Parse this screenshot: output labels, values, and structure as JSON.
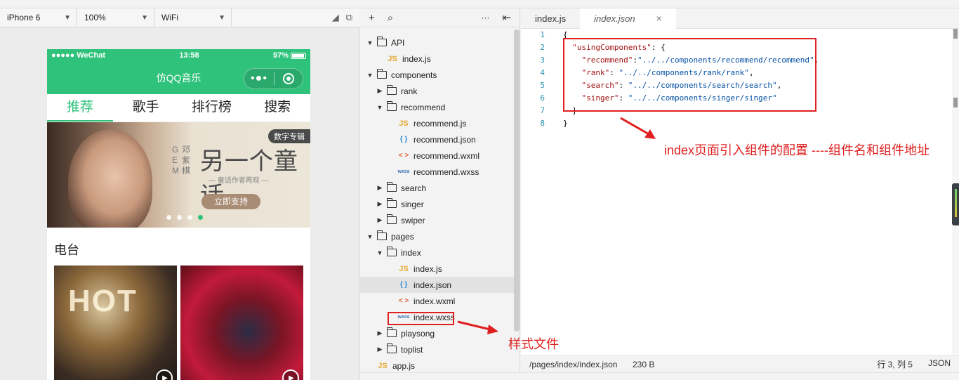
{
  "simulator": {
    "device": "iPhone 6",
    "zoom": "100%",
    "network": "WiFi",
    "status": {
      "carrier": "●●●●● WeChat",
      "time": "13:58",
      "battery": "97%"
    },
    "nav_title": "仿QQ音乐",
    "capsule_dots": "•●•",
    "tabs": [
      "推荐",
      "歌手",
      "排行榜",
      "搜索"
    ],
    "banner": {
      "album_tag": "数字专辑",
      "artist_col1": [
        "G",
        "E",
        "M"
      ],
      "artist_col2": [
        "邓",
        "紫",
        "棋"
      ],
      "title": "另一个童话",
      "subtitle": "— 童话作者再现 —",
      "support": "立即支持"
    },
    "radio_title": "电台",
    "radio_hot": "HOT"
  },
  "tree_toolbar": {
    "add": "+",
    "search": "⌕",
    "more": "···",
    "collapse": "⇤"
  },
  "file_tree": [
    {
      "label": "API",
      "type": "folder",
      "open": true,
      "level": 0
    },
    {
      "label": "index.js",
      "type": "js",
      "level": 1
    },
    {
      "label": "components",
      "type": "folder",
      "open": true,
      "level": 0
    },
    {
      "label": "rank",
      "type": "folder",
      "open": false,
      "level": 1
    },
    {
      "label": "recommend",
      "type": "folder",
      "open": true,
      "level": 1
    },
    {
      "label": "recommend.js",
      "type": "js",
      "level": 2
    },
    {
      "label": "recommend.json",
      "type": "json",
      "level": 2
    },
    {
      "label": "recommend.wxml",
      "type": "wxml",
      "level": 2
    },
    {
      "label": "recommend.wxss",
      "type": "wxss",
      "level": 2
    },
    {
      "label": "search",
      "type": "folder",
      "open": false,
      "level": 1
    },
    {
      "label": "singer",
      "type": "folder",
      "open": false,
      "level": 1
    },
    {
      "label": "swiper",
      "type": "folder",
      "open": false,
      "level": 1
    },
    {
      "label": "pages",
      "type": "folder",
      "open": true,
      "level": 0
    },
    {
      "label": "index",
      "type": "folder",
      "open": true,
      "level": 1
    },
    {
      "label": "index.js",
      "type": "js",
      "level": 2
    },
    {
      "label": "index.json",
      "type": "json",
      "level": 2,
      "selected": true
    },
    {
      "label": "index.wxml",
      "type": "wxml",
      "level": 2
    },
    {
      "label": "index.wxss",
      "type": "wxss",
      "level": 2
    },
    {
      "label": "playsong",
      "type": "folder",
      "open": false,
      "level": 1
    },
    {
      "label": "toplist",
      "type": "folder",
      "open": false,
      "level": 1
    },
    {
      "label": "app.js",
      "type": "js",
      "level": 0
    }
  ],
  "file_icons": {
    "js": "JS",
    "json": "{ }",
    "wxml": "< >",
    "wxss": "wxss"
  },
  "editor": {
    "tabs": [
      {
        "label": "index.js",
        "active": false
      },
      {
        "label": "index.json",
        "active": true,
        "close": "×"
      }
    ],
    "line_numbers": [
      "1",
      "2",
      "3",
      "4",
      "5",
      "6",
      "7",
      "8"
    ],
    "code": {
      "l1": "{",
      "l2_key": "\"usingComponents\"",
      "l2_rest": ": {",
      "l3_key": "\"recommend\"",
      "l3_sep": ":",
      "l3_val": "\"../../components/recommend/recommend\"",
      "l3_end": ",",
      "l4_key": "\"rank\"",
      "l4_sep": ": ",
      "l4_val": "\"../../components/rank/rank\"",
      "l4_end": ",",
      "l5_key": "\"search\"",
      "l5_sep": ": ",
      "l5_val": "\"../../components/search/search\"",
      "l5_end": ",",
      "l6_key": "\"singer\"",
      "l6_sep": ": ",
      "l6_val": "\"../../components/singer/singer\"",
      "l7": "}",
      "l8": "}"
    },
    "annotation_config": "index页面引入组件的配置  ----组件名和组件地址",
    "annotation_style": "样式文件",
    "status": {
      "path": "/pages/index/index.json",
      "size": "230 B",
      "position": "行 3, 列 5",
      "language": "JSON"
    }
  },
  "colors": {
    "wechat_green": "#2fc27b",
    "annotation_red": "#e02020"
  }
}
